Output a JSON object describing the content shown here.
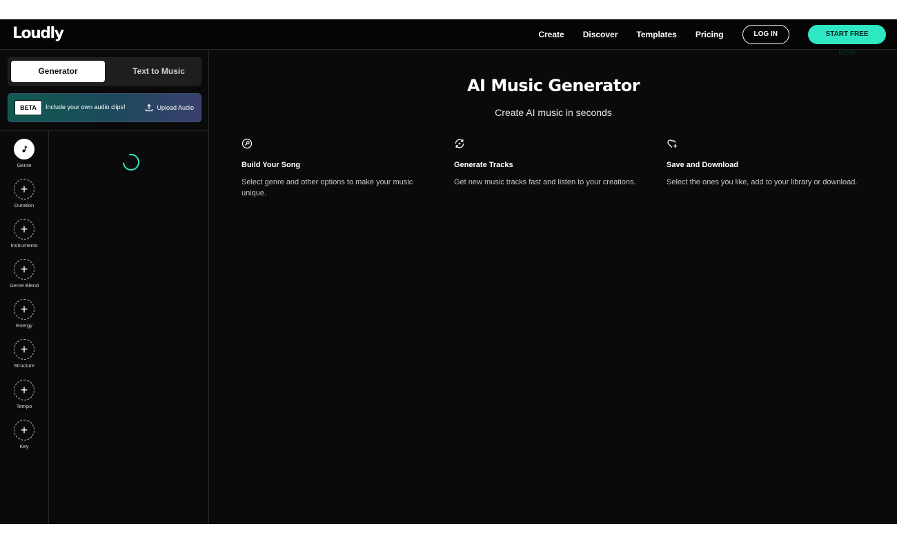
{
  "header": {
    "logo": "Loudly",
    "nav": [
      "Create",
      "Discover",
      "Templates",
      "Pricing"
    ],
    "login_label": "LOG IN",
    "start_label": "START FREE NOW"
  },
  "left": {
    "tabs": {
      "generator": "Generator",
      "text_to_music": "Text to Music"
    },
    "beta": {
      "badge": "BETA",
      "text": "Include your own audio clips!",
      "upload_label": "Upload Audio"
    },
    "params": [
      "Genre",
      "Duration",
      "Instruments",
      "Genre Blend",
      "Energy",
      "Structure",
      "Tempo",
      "Key"
    ]
  },
  "main": {
    "title": "AI Music Generator",
    "subtitle": "Create AI music in seconds",
    "features": [
      {
        "icon": "wrench-icon",
        "title": "Build Your Song",
        "desc": "Select genre and other options to make your music unique."
      },
      {
        "icon": "refresh-icon",
        "title": "Generate Tracks",
        "desc": "Get new music tracks fast and listen to your creations."
      },
      {
        "icon": "heart-plus-icon",
        "title": "Save and Download",
        "desc": "Select the ones you like, add to your library or download."
      }
    ]
  },
  "colors": {
    "accent": "#2ee8c4",
    "background": "#0a0a0a"
  }
}
